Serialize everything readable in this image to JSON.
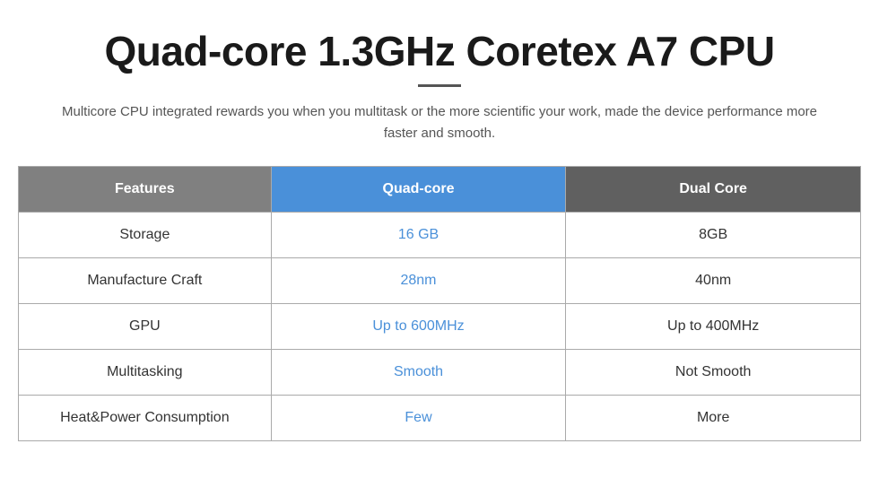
{
  "title": "Quad-core 1.3GHz Coretex A7 CPU",
  "subtitle": "Multicore CPU integrated rewards you when you multitask or the more scientific your work, made the device performance more faster and smooth.",
  "table": {
    "headers": {
      "features": "Features",
      "quadcore": "Quad-core",
      "dualcore": "Dual Core"
    },
    "rows": [
      {
        "feature": "Storage",
        "quadcore_val": "16 GB",
        "dualcore_val": "8GB"
      },
      {
        "feature": "Manufacture Craft",
        "quadcore_val": "28nm",
        "dualcore_val": "40nm"
      },
      {
        "feature": "GPU",
        "quadcore_val": "Up to 600MHz",
        "dualcore_val": "Up to 400MHz"
      },
      {
        "feature": "Multitasking",
        "quadcore_val": "Smooth",
        "dualcore_val": "Not Smooth"
      },
      {
        "feature": "Heat&Power Consumption",
        "quadcore_val": "Few",
        "dualcore_val": "More"
      }
    ]
  }
}
